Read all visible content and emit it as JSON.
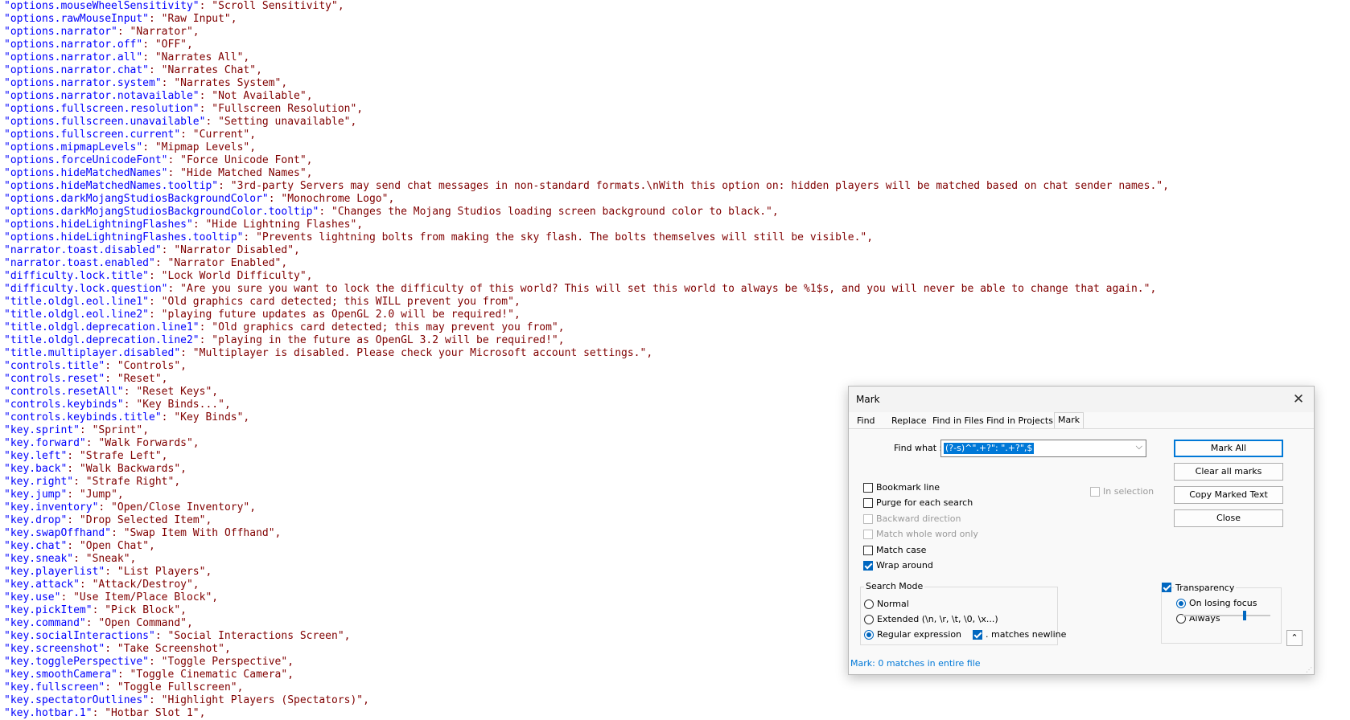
{
  "editor": {
    "lines": [
      {
        "k": "\"options.mouseWheelSensitivity\"",
        "v": ": \"Scroll Sensitivity\","
      },
      {
        "k": "\"options.rawMouseInput\"",
        "v": ": \"Raw Input\","
      },
      {
        "k": "\"options.narrator\"",
        "v": ": \"Narrator\","
      },
      {
        "k": "\"options.narrator.off\"",
        "v": ": \"OFF\","
      },
      {
        "k": "\"options.narrator.all\"",
        "v": ": \"Narrates All\","
      },
      {
        "k": "\"options.narrator.chat\"",
        "v": ": \"Narrates Chat\","
      },
      {
        "k": "\"options.narrator.system\"",
        "v": ": \"Narrates System\","
      },
      {
        "k": "\"options.narrator.notavailable\"",
        "v": ": \"Not Available\","
      },
      {
        "k": "\"options.fullscreen.resolution\"",
        "v": ": \"Fullscreen Resolution\","
      },
      {
        "k": "\"options.fullscreen.unavailable\"",
        "v": ": \"Setting unavailable\","
      },
      {
        "k": "\"options.fullscreen.current\"",
        "v": ": \"Current\","
      },
      {
        "k": "\"options.mipmapLevels\"",
        "v": ": \"Mipmap Levels\","
      },
      {
        "k": "\"options.forceUnicodeFont\"",
        "v": ": \"Force Unicode Font\","
      },
      {
        "k": "\"options.hideMatchedNames\"",
        "v": ": \"Hide Matched Names\","
      },
      {
        "k": "\"options.hideMatchedNames.tooltip\"",
        "v": ": \"3rd-party Servers may send chat messages in non-standard formats.\\nWith this option on: hidden players will be matched based on chat sender names.\","
      },
      {
        "k": "\"options.darkMojangStudiosBackgroundColor\"",
        "v": ": \"Monochrome Logo\","
      },
      {
        "k": "\"options.darkMojangStudiosBackgroundColor.tooltip\"",
        "v": ": \"Changes the Mojang Studios loading screen background color to black.\","
      },
      {
        "k": "\"options.hideLightningFlashes\"",
        "v": ": \"Hide Lightning Flashes\","
      },
      {
        "k": "\"options.hideLightningFlashes.tooltip\"",
        "v": ": \"Prevents lightning bolts from making the sky flash. The bolts themselves will still be visible.\","
      },
      {
        "k": "\"narrator.toast.disabled\"",
        "v": ": \"Narrator Disabled\","
      },
      {
        "k": "\"narrator.toast.enabled\"",
        "v": ": \"Narrator Enabled\","
      },
      {
        "k": "\"difficulty.lock.title\"",
        "v": ": \"Lock World Difficulty\","
      },
      {
        "k": "\"difficulty.lock.question\"",
        "v": ": \"Are you sure you want to lock the difficulty of this world? This will set this world to always be %1$s, and you will never be able to change that again.\","
      },
      {
        "k": "\"title.oldgl.eol.line1\"",
        "v": ": \"Old graphics card detected; this WILL prevent you from\","
      },
      {
        "k": "\"title.oldgl.eol.line2\"",
        "v": ": \"playing future updates as OpenGL 2.0 will be required!\","
      },
      {
        "k": "\"title.oldgl.deprecation.line1\"",
        "v": ": \"Old graphics card detected; this may prevent you from\","
      },
      {
        "k": "\"title.oldgl.deprecation.line2\"",
        "v": ": \"playing in the future as OpenGL 3.2 will be required!\","
      },
      {
        "k": "\"title.multiplayer.disabled\"",
        "v": ": \"Multiplayer is disabled. Please check your Microsoft account settings.\","
      },
      {
        "k": "\"controls.title\"",
        "v": ": \"Controls\","
      },
      {
        "k": "\"controls.reset\"",
        "v": ": \"Reset\","
      },
      {
        "k": "\"controls.resetAll\"",
        "v": ": \"Reset Keys\","
      },
      {
        "k": "\"controls.keybinds\"",
        "v": ": \"Key Binds...\","
      },
      {
        "k": "\"controls.keybinds.title\"",
        "v": ": \"Key Binds\","
      },
      {
        "k": "\"key.sprint\"",
        "v": ": \"Sprint\","
      },
      {
        "k": "\"key.forward\"",
        "v": ": \"Walk Forwards\","
      },
      {
        "k": "\"key.left\"",
        "v": ": \"Strafe Left\","
      },
      {
        "k": "\"key.back\"",
        "v": ": \"Walk Backwards\","
      },
      {
        "k": "\"key.right\"",
        "v": ": \"Strafe Right\","
      },
      {
        "k": "\"key.jump\"",
        "v": ": \"Jump\","
      },
      {
        "k": "\"key.inventory\"",
        "v": ": \"Open/Close Inventory\","
      },
      {
        "k": "\"key.drop\"",
        "v": ": \"Drop Selected Item\","
      },
      {
        "k": "\"key.swapOffhand\"",
        "v": ": \"Swap Item With Offhand\","
      },
      {
        "k": "\"key.chat\"",
        "v": ": \"Open Chat\","
      },
      {
        "k": "\"key.sneak\"",
        "v": ": \"Sneak\","
      },
      {
        "k": "\"key.playerlist\"",
        "v": ": \"List Players\","
      },
      {
        "k": "\"key.attack\"",
        "v": ": \"Attack/Destroy\","
      },
      {
        "k": "\"key.use\"",
        "v": ": \"Use Item/Place Block\","
      },
      {
        "k": "\"key.pickItem\"",
        "v": ": \"Pick Block\","
      },
      {
        "k": "\"key.command\"",
        "v": ": \"Open Command\","
      },
      {
        "k": "\"key.socialInteractions\"",
        "v": ": \"Social Interactions Screen\","
      },
      {
        "k": "\"key.screenshot\"",
        "v": ": \"Take Screenshot\","
      },
      {
        "k": "\"key.togglePerspective\"",
        "v": ": \"Toggle Perspective\","
      },
      {
        "k": "\"key.smoothCamera\"",
        "v": ": \"Toggle Cinematic Camera\","
      },
      {
        "k": "\"key.fullscreen\"",
        "v": ": \"Toggle Fullscreen\","
      },
      {
        "k": "\"key.spectatorOutlines\"",
        "v": ": \"Highlight Players (Spectators)\","
      },
      {
        "k": "\"key.hotbar.1\"",
        "v": ": \"Hotbar Slot 1\","
      }
    ]
  },
  "dialog": {
    "title": "Mark",
    "close_icon": "close-icon",
    "tabs": [
      "Find",
      "Replace",
      "Find in Files",
      "Find in Projects",
      "Mark"
    ],
    "active_tab": "Mark",
    "find_what_label": "Find what :",
    "find_what_value": "(?-s)^\".+?\": \".+?\",$",
    "buttons": {
      "mark_all": "Mark All",
      "clear_all_marks": "Clear all marks",
      "copy_marked_text": "Copy Marked Text",
      "close": "Close"
    },
    "options": {
      "bookmark_line": {
        "label": "Bookmark line",
        "checked": false
      },
      "purge": {
        "label": "Purge for each search",
        "checked": false
      },
      "backward": {
        "label": "Backward direction",
        "checked": false,
        "disabled": true
      },
      "whole_word": {
        "label": "Match whole word only",
        "checked": false,
        "disabled": true
      },
      "match_case": {
        "label": "Match case",
        "checked": false
      },
      "wrap_around": {
        "label": "Wrap around",
        "checked": true
      },
      "in_selection": {
        "label": "In selection",
        "checked": false,
        "disabled": true
      }
    },
    "search_mode": {
      "title": "Search Mode",
      "normal": "Normal",
      "extended": "Extended (\\n, \\r, \\t, \\0, \\x...)",
      "regex": "Regular expression",
      "selected": "Regular expression",
      "matches_newline": {
        "label": ". matches newline",
        "checked": true
      }
    },
    "transparency": {
      "label": "Transparency",
      "checked": true,
      "on_losing_focus": "On losing focus",
      "always": "Always",
      "selected": "On losing focus",
      "level": 0.72
    },
    "status": "Mark: 0 matches in entire file",
    "colors": {
      "accent": "#0067c0",
      "key": "#0000ff",
      "value": "#800000",
      "status": "#0078d7"
    }
  }
}
